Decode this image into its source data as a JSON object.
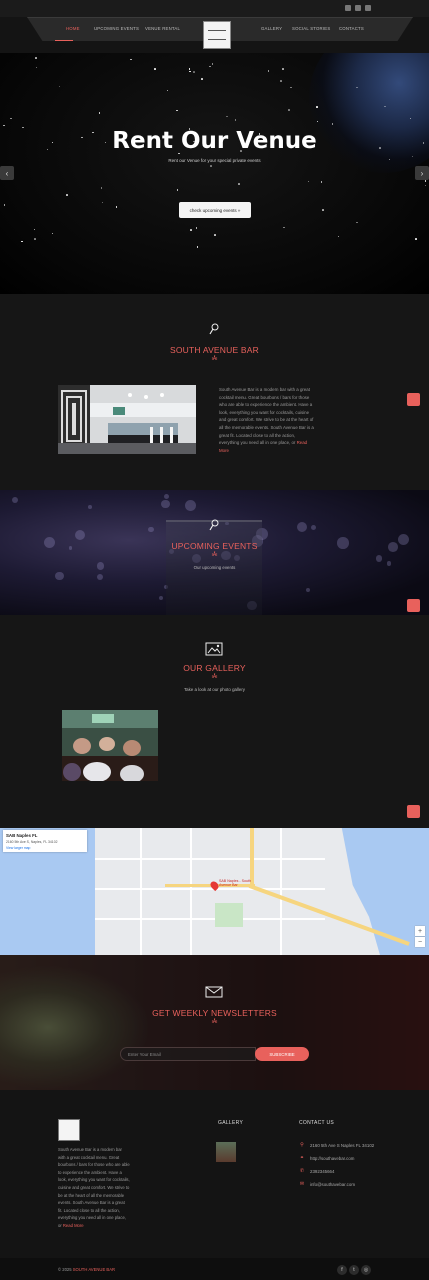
{
  "nav": {
    "items_left": [
      "HOME",
      "UPCOMING EVENTS",
      "VENUE RENTAL"
    ],
    "items_right": [
      "GALLERY",
      "SOCIAL STORIES",
      "CONTACTS"
    ],
    "active": "HOME",
    "accent": "#e8615c"
  },
  "hero": {
    "title": "Rent Our Venue",
    "subtitle": "Rent our Venue for your special private events",
    "button_label": "check upcoming events »",
    "prev_icon": "‹",
    "next_icon": "›"
  },
  "bar_section": {
    "icon": "microphone-icon",
    "title": "SOUTH AVENUE BAR",
    "divider": "ıÅı",
    "text": "South Avenue Bar is a modern bar with a great cocktail menu. Great bourbons / bars for those who are able to experience the ambient. Have a look, everything you want for cocktails, cuisine and great comfort. We strive to be at the heart of all the memorable events. South Avenue Bar is a great fit. Located close to all the action, everything you need all in one place, or ",
    "more": "Read More"
  },
  "events_section": {
    "title": "UPCOMING EVENTS",
    "divider": "ıÅı",
    "subtitle": "Our upcoming events"
  },
  "gallery_section": {
    "title": "OUR GALLERY",
    "divider": "ıÅı",
    "subtitle": "Take a look at our photo gallery"
  },
  "map": {
    "place_name": "SAB Naples FL",
    "address": "2160 5th Ave S, Naples, FL 34102",
    "link": "View larger map",
    "pin_label": "SAB Naples - South Avenue Bar"
  },
  "newsletter": {
    "title": "GET WEEKLY NEWSLETTERS",
    "divider": "ıÅı",
    "placeholder": "Enter Your Email",
    "button_label": "SUBSCRIBE"
  },
  "footer": {
    "about": "South Avenue Bar is a modern bar with a great cocktail menu. Great bourbons / bars for those who are able to experience the ambient. Have a look, everything you want for cocktails, cuisine and great comfort. We strive to be at the heart of all the memorable events. South Avenue Bar is a great fit. Located close to all the action, everything you need all in one place, or ",
    "about_more": "Read More",
    "gallery_heading": "GALLERY",
    "contact_heading": "CONTACT US",
    "contacts": [
      {
        "icon": "location-icon",
        "glyph": "⚲",
        "text": "2160 5th Ave S Naples FL 34102"
      },
      {
        "icon": "link-icon",
        "glyph": "⚭",
        "text": "http://southavebar.com"
      },
      {
        "icon": "phone-icon",
        "glyph": "✆",
        "text": "2392345664"
      },
      {
        "icon": "mail-icon",
        "glyph": "✉",
        "text": "info@southavebar.com"
      }
    ],
    "copyright": "© 2025 ",
    "brand": "SOUTH AVENUE BAR"
  }
}
